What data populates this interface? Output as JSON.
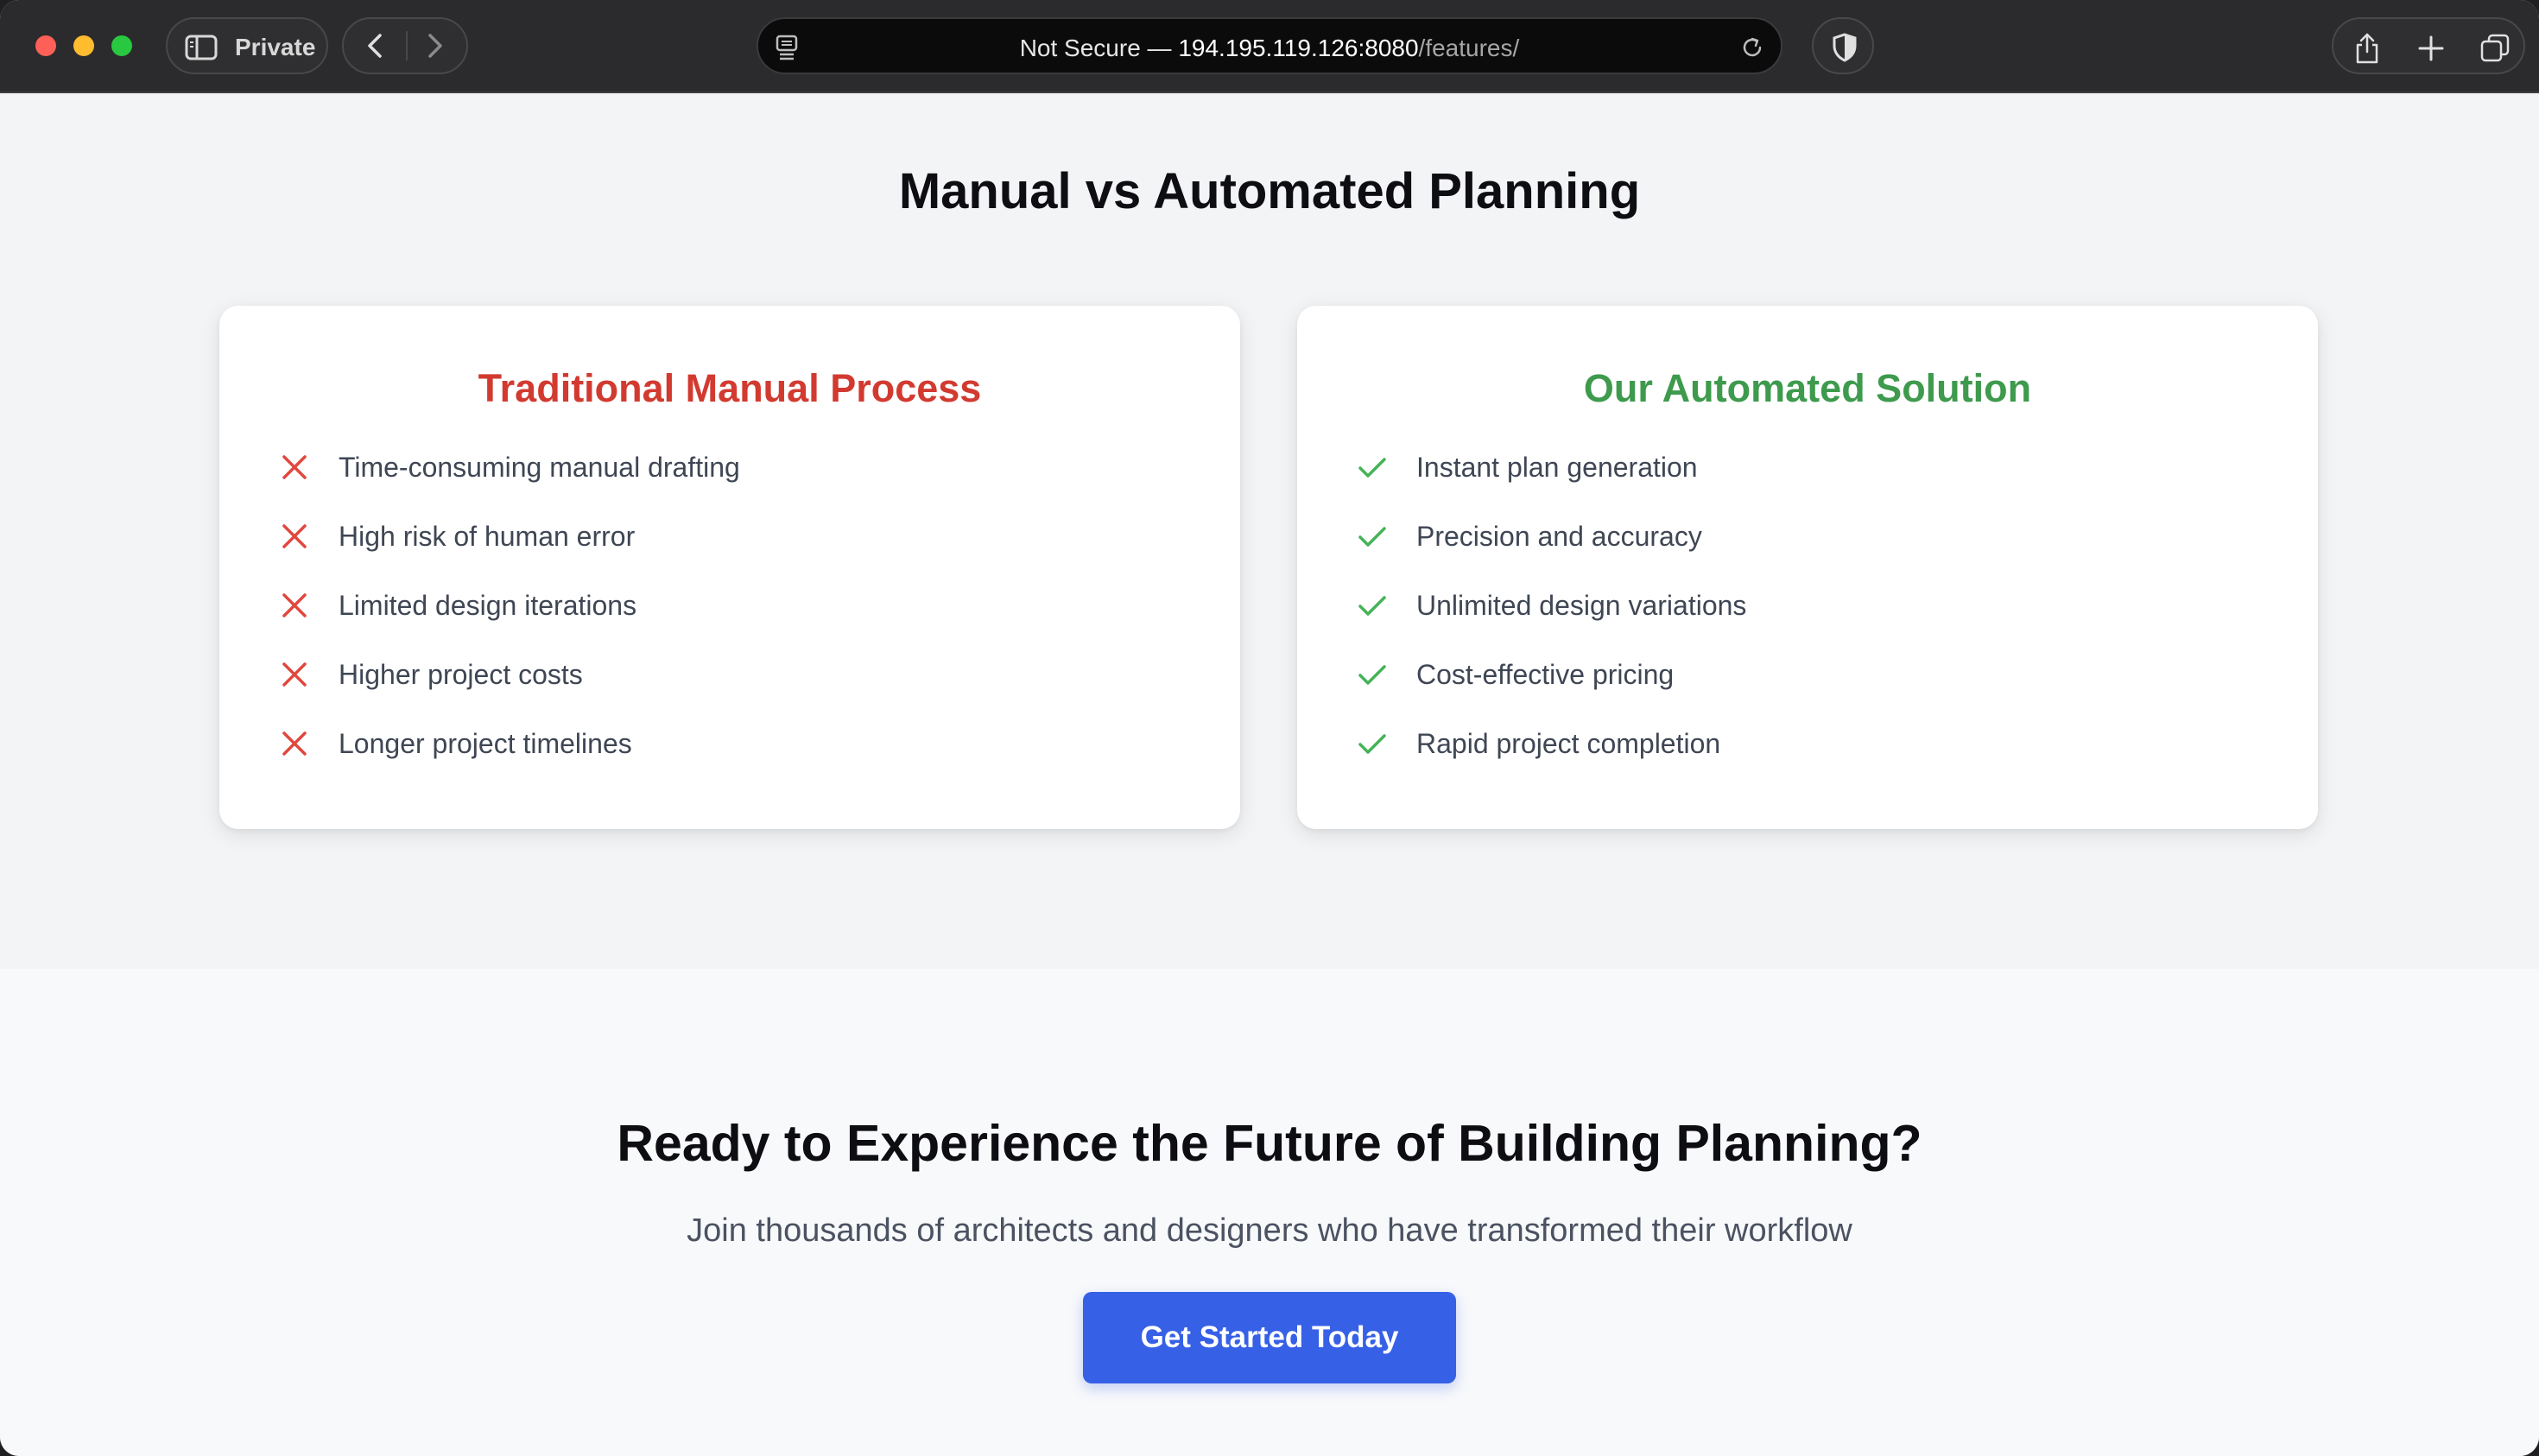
{
  "browser": {
    "private_label": "Private",
    "url_prefix": "Not Secure — ",
    "url_host": "194.195.119.126:8080",
    "url_path": "/features/"
  },
  "comparison": {
    "title": "Manual vs Automated Planning",
    "manual": {
      "heading": "Traditional Manual Process",
      "color": "#d23a30",
      "icon": "x-icon",
      "items": [
        "Time-consuming manual drafting",
        "High risk of human error",
        "Limited design iterations",
        "Higher project costs",
        "Longer project timelines"
      ]
    },
    "automated": {
      "heading": "Our Automated Solution",
      "color": "#3e9a4d",
      "icon": "check-icon",
      "items": [
        "Instant plan generation",
        "Precision and accuracy",
        "Unlimited design variations",
        "Cost-effective pricing",
        "Rapid project completion"
      ]
    }
  },
  "cta": {
    "title": "Ready to Experience the Future of Building Planning?",
    "subtitle": "Join thousands of architects and designers who have transformed their workflow",
    "button_label": "Get Started Today",
    "button_color": "#3660e6"
  }
}
